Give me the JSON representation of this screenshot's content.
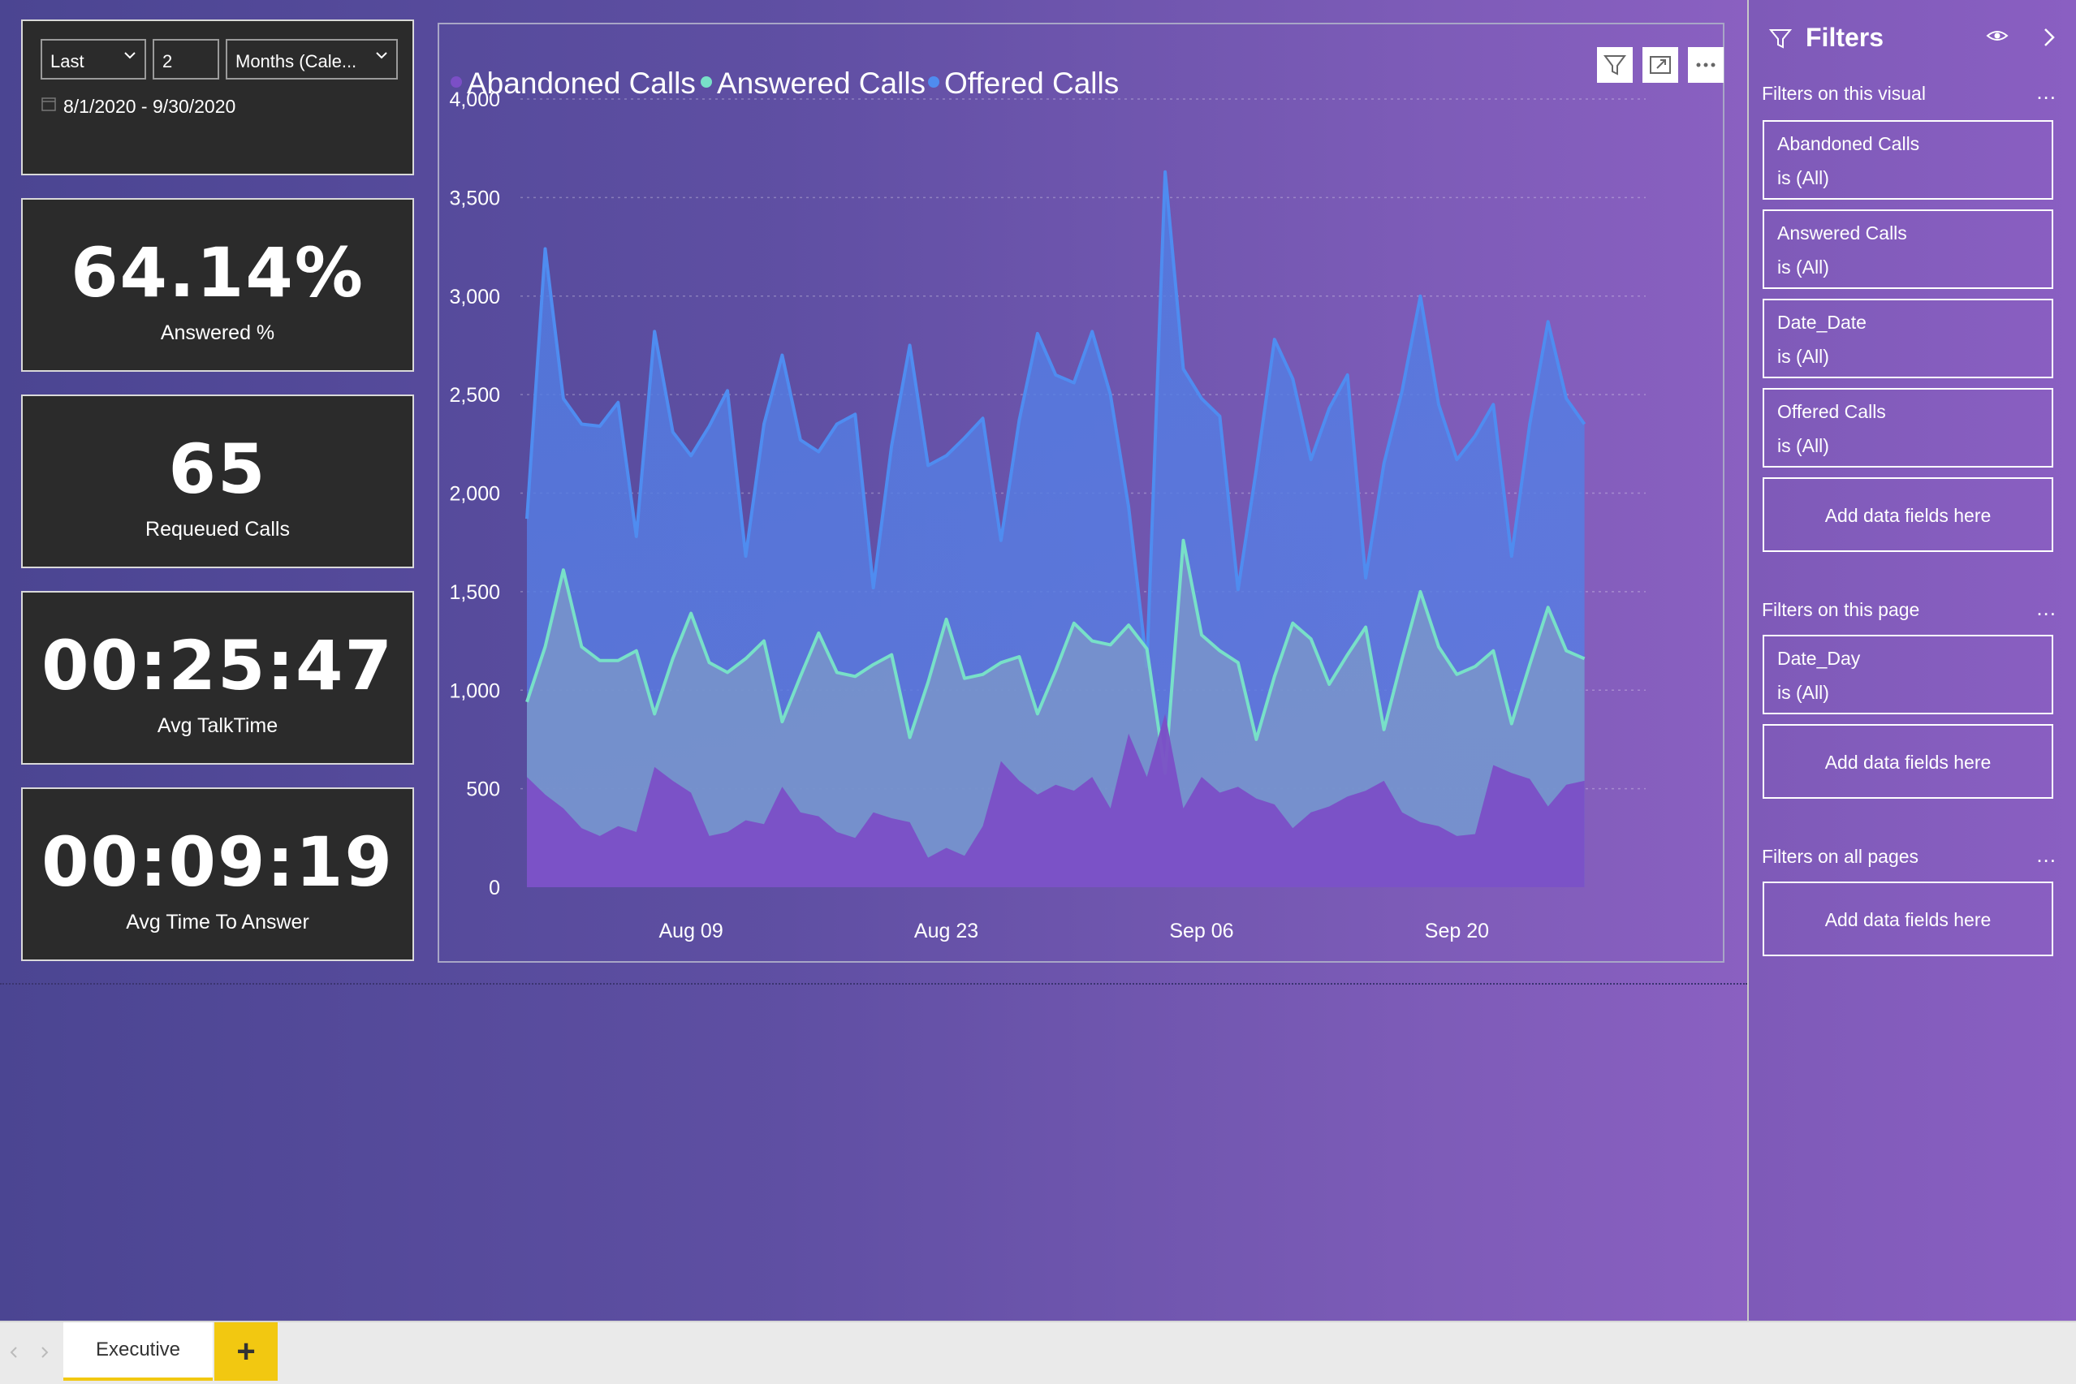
{
  "date_filter": {
    "relative": "Last",
    "count": "2",
    "unit": "Months (Cale...",
    "range": "8/1/2020 - 9/30/2020"
  },
  "kpis": [
    {
      "value": "64.14%",
      "label": "Answered %"
    },
    {
      "value": "65",
      "label": "Requeued Calls"
    },
    {
      "value": "00:25:47",
      "label": "Avg TalkTime"
    },
    {
      "value": "00:09:19",
      "label": "Avg Time To Answer"
    }
  ],
  "chart": {
    "legend": [
      "Abandoned Calls",
      "Answered Calls",
      "Offered Calls"
    ],
    "colors": {
      "abandoned": "#7b4fc6",
      "answered": "#78e0c8",
      "offered": "#4f8cf0"
    }
  },
  "chart_data": {
    "type": "area",
    "y_ticks": [
      "4,000",
      "3,500",
      "3,000",
      "2,500",
      "2,000",
      "1,500",
      "1,000",
      "500",
      "0"
    ],
    "x_ticks": [
      "Aug 09",
      "Aug 23",
      "Sep 06",
      "Sep 20"
    ],
    "ylim": [
      0,
      4000
    ],
    "grid": true,
    "legend_position": "top-left",
    "x": [
      "2020-07-31",
      "2020-08-01",
      "2020-08-02",
      "2020-08-03",
      "2020-08-04",
      "2020-08-05",
      "2020-08-06",
      "2020-08-07",
      "2020-08-08",
      "2020-08-09",
      "2020-08-10",
      "2020-08-11",
      "2020-08-12",
      "2020-08-13",
      "2020-08-14",
      "2020-08-15",
      "2020-08-16",
      "2020-08-17",
      "2020-08-18",
      "2020-08-19",
      "2020-08-20",
      "2020-08-21",
      "2020-08-22",
      "2020-08-23",
      "2020-08-24",
      "2020-08-25",
      "2020-08-26",
      "2020-08-27",
      "2020-08-28",
      "2020-08-29",
      "2020-08-30",
      "2020-08-31",
      "2020-09-01",
      "2020-09-02",
      "2020-09-03",
      "2020-09-04",
      "2020-09-05",
      "2020-09-06",
      "2020-09-07",
      "2020-09-08",
      "2020-09-09",
      "2020-09-10",
      "2020-09-11",
      "2020-09-12",
      "2020-09-13",
      "2020-09-14",
      "2020-09-15",
      "2020-09-16",
      "2020-09-17",
      "2020-09-18",
      "2020-09-19",
      "2020-09-20",
      "2020-09-21",
      "2020-09-22",
      "2020-09-23",
      "2020-09-24",
      "2020-09-25",
      "2020-09-26",
      "2020-09-27",
      "2020-09-28",
      "2020-09-29",
      "2020-09-30"
    ],
    "series": [
      {
        "name": "Offered Calls",
        "values": [
          1870,
          3240,
          2480,
          2350,
          2340,
          2460,
          1780,
          2820,
          2310,
          2190,
          2340,
          2520,
          1680,
          2350,
          2700,
          2270,
          2210,
          2350,
          2400,
          1520,
          2240,
          2750,
          2140,
          2190,
          2280,
          2380,
          1760,
          2370,
          2810,
          2600,
          2560,
          2820,
          2500,
          1930,
          1120,
          3630,
          2630,
          2480,
          2390,
          1510,
          2120,
          2780,
          2580,
          2170,
          2430,
          2600,
          1570,
          2150,
          2520,
          3000,
          2450,
          2170,
          2290,
          2450,
          1680,
          2350,
          2870,
          2480,
          2350
        ]
      },
      {
        "name": "Answered Calls",
        "values": [
          940,
          1220,
          1610,
          1220,
          1150,
          1150,
          1200,
          880,
          1160,
          1390,
          1140,
          1090,
          1160,
          1250,
          840,
          1070,
          1290,
          1090,
          1070,
          1130,
          1180,
          760,
          1040,
          1360,
          1060,
          1080,
          1140,
          1170,
          880,
          1100,
          1340,
          1250,
          1230,
          1330,
          1210,
          580,
          1760,
          1280,
          1200,
          1140,
          750,
          1070,
          1340,
          1260,
          1030,
          1180,
          1320,
          800,
          1160,
          1500,
          1220,
          1080,
          1120,
          1200,
          830,
          1130,
          1420,
          1200,
          1160
        ]
      },
      {
        "name": "Abandoned Calls",
        "values": [
          560,
          470,
          400,
          300,
          260,
          310,
          280,
          610,
          540,
          480,
          260,
          280,
          340,
          320,
          510,
          380,
          360,
          280,
          250,
          380,
          350,
          330,
          150,
          200,
          160,
          310,
          640,
          540,
          470,
          520,
          490,
          560,
          400,
          780,
          560,
          880,
          400,
          560,
          480,
          510,
          450,
          420,
          300,
          380,
          410,
          460,
          490,
          540,
          380,
          330,
          310,
          260,
          270,
          620,
          580,
          550,
          410,
          520,
          540
        ]
      }
    ]
  },
  "filters_pane": {
    "title": "Filters",
    "section_visual": "Filters on this visual",
    "visual_filters": [
      {
        "name": "Abandoned Calls",
        "value": "is (All)"
      },
      {
        "name": "Answered Calls",
        "value": "is (All)"
      },
      {
        "name": "Date_Date",
        "value": "is (All)"
      },
      {
        "name": "Offered Calls",
        "value": "is (All)"
      }
    ],
    "add_fields": "Add data fields here",
    "section_page": "Filters on this page",
    "page_filters": [
      {
        "name": "Date_Day",
        "value": "is (All)"
      }
    ],
    "section_all": "Filters on all pages",
    "more": "..."
  },
  "tabs": {
    "active": "Executive",
    "add": "+"
  }
}
